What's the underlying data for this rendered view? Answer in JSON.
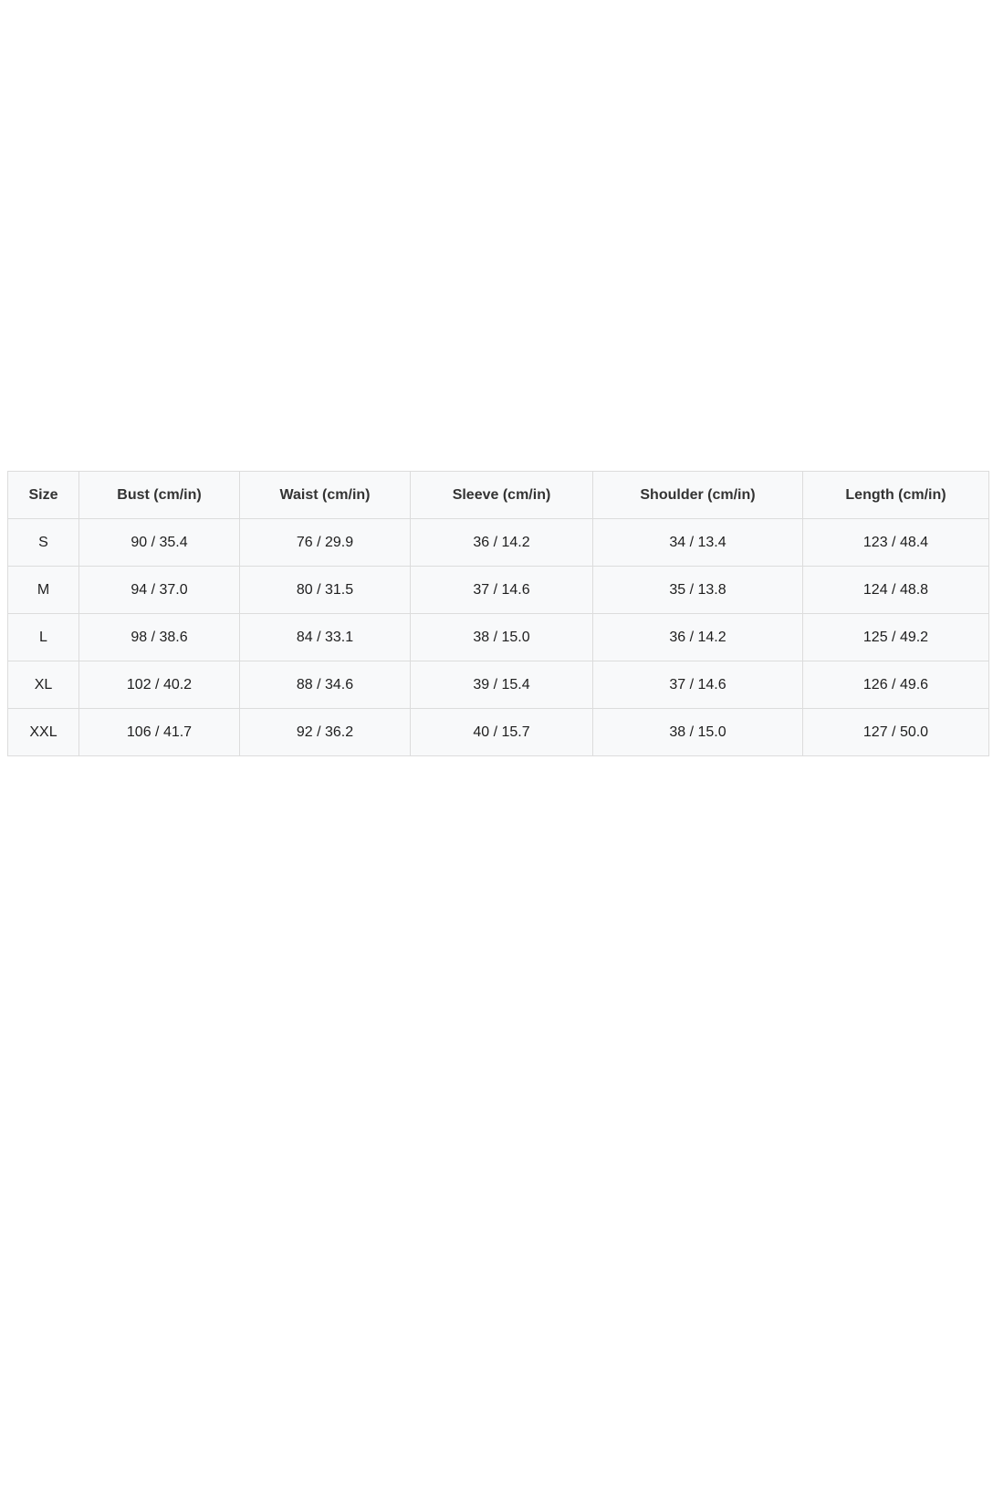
{
  "table": {
    "headers": [
      "Size",
      "Bust (cm/in)",
      "Waist (cm/in)",
      "Sleeve (cm/in)",
      "Shoulder (cm/in)",
      "Length (cm/in)"
    ],
    "rows": [
      [
        "S",
        "90 / 35.4",
        "76 / 29.9",
        "36 / 14.2",
        "34 / 13.4",
        "123 / 48.4"
      ],
      [
        "M",
        "94 / 37.0",
        "80 / 31.5",
        "37 / 14.6",
        "35 / 13.8",
        "124 / 48.8"
      ],
      [
        "L",
        "98 / 38.6",
        "84 / 33.1",
        "38 / 15.0",
        "36 / 14.2",
        "125 / 49.2"
      ],
      [
        "XL",
        "102 / 40.2",
        "88 / 34.6",
        "39 / 15.4",
        "37 / 14.6",
        "126 / 49.6"
      ],
      [
        "XXL",
        "106 / 41.7",
        "92 / 36.2",
        "40 / 15.7",
        "38 / 15.0",
        "127 / 50.0"
      ]
    ]
  },
  "colors": {
    "cell_background": "#f8f9fa",
    "border": "#dcdcdc",
    "text": "#1e1e1e"
  }
}
